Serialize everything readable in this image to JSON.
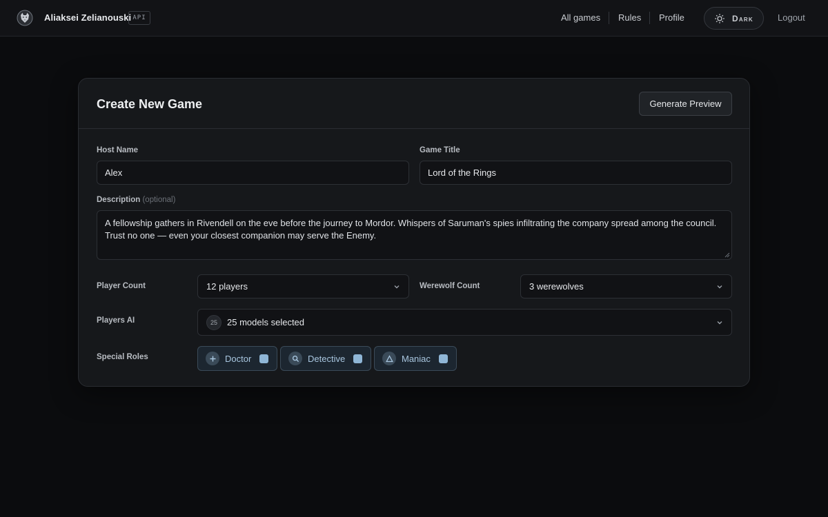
{
  "header": {
    "user_name": "Aliaksei Zelianouski",
    "api_badge": "API",
    "nav": [
      {
        "label": "All games"
      },
      {
        "label": "Rules"
      },
      {
        "label": "Profile"
      }
    ],
    "theme_label": "Dark",
    "logout_label": "Logout"
  },
  "card": {
    "title": "Create New Game",
    "preview_button": "Generate Preview",
    "host_name": {
      "label": "Host Name",
      "value": "Alex"
    },
    "game_title": {
      "label": "Game Title",
      "value": "Lord of the Rings"
    },
    "description": {
      "label": "Description",
      "optional": "(optional)",
      "value": "A fellowship gathers in Rivendell on the eve before the journey to Mordor. Whispers of Saruman's spies infiltrating the company spread among the council. Trust no one — even your closest companion may serve the Enemy."
    },
    "player_count": {
      "label": "Player Count",
      "value": "12 players"
    },
    "werewolf_count": {
      "label": "Werewolf Count",
      "value": "3 werewolves"
    },
    "players_ai": {
      "label": "Players AI",
      "count": "25",
      "value": "25 models selected"
    },
    "special_roles": {
      "label": "Special Roles",
      "roles": [
        {
          "label": "Doctor",
          "icon": "plus-icon"
        },
        {
          "label": "Detective",
          "icon": "search-icon"
        },
        {
          "label": "Maniac",
          "icon": "triangle-icon"
        }
      ]
    }
  },
  "colors": {
    "background": "#0b0c0e",
    "card": "#16181b",
    "accent_chip": "#1c2630",
    "accent_text": "#a9c7e0"
  }
}
